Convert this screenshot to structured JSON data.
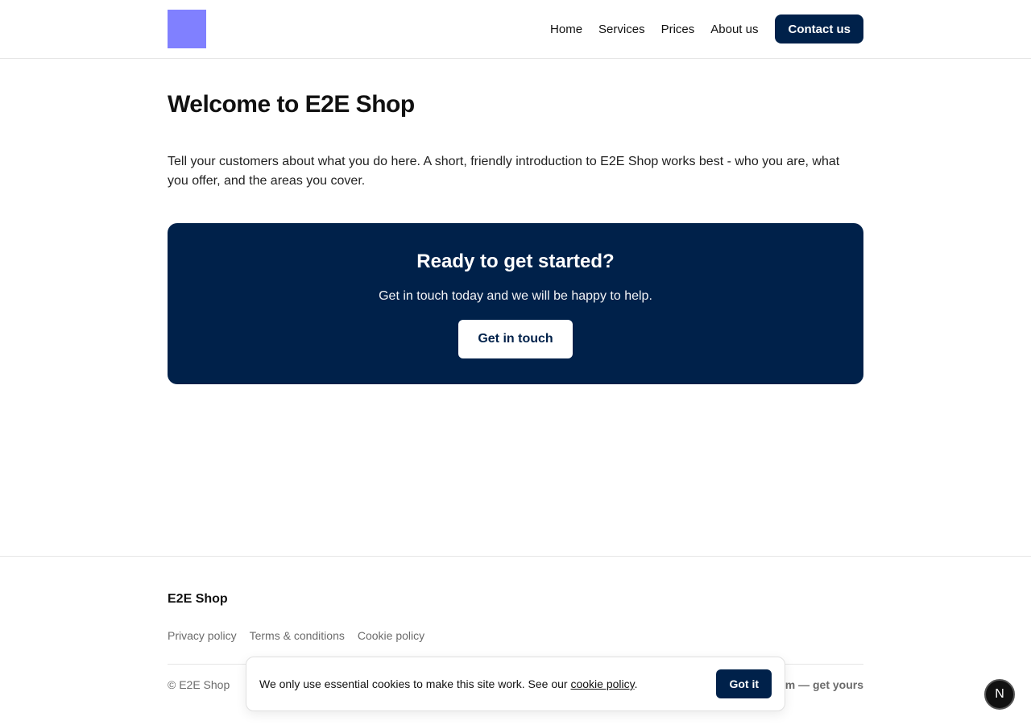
{
  "header": {
    "logo": {
      "color": "#8080ff"
    },
    "nav": [
      {
        "label": "Home"
      },
      {
        "label": "Services"
      },
      {
        "label": "Prices"
      },
      {
        "label": "About us"
      }
    ],
    "contact_label": "Contact us"
  },
  "main": {
    "title": "Welcome to E2E Shop",
    "intro": "Tell your customers about what you do here. A short, friendly introduction to E2E Shop works best - who you are, what you offer, and the areas you cover.",
    "cta": {
      "title": "Ready to get started?",
      "text": "Get in touch today and we will be happy to help.",
      "button_label": "Get in touch"
    }
  },
  "footer": {
    "brand": "E2E Shop",
    "links": [
      {
        "label": "Privacy policy"
      },
      {
        "label": "Terms & conditions"
      },
      {
        "label": "Cookie policy"
      }
    ],
    "copyright": "© E2E Shop",
    "getyours_visible": "m — get yours"
  },
  "cookie": {
    "text_before": "We only use essential cookies to make this site work. See our ",
    "link_label": "cookie policy",
    "text_after": ".",
    "button_label": "Got it"
  },
  "badge": {
    "label": "N"
  },
  "colors": {
    "brand": "#00214a",
    "logo": "#8080ff"
  }
}
